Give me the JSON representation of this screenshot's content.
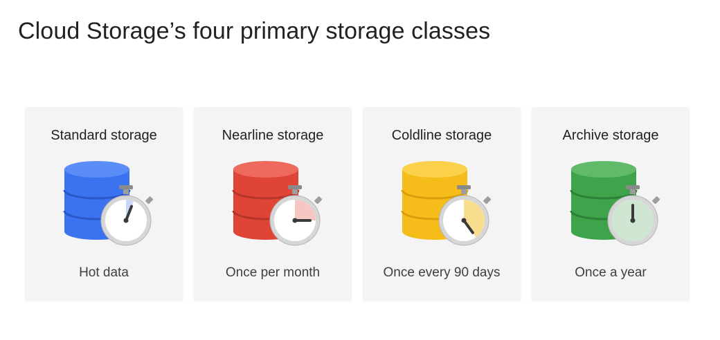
{
  "slide": {
    "title": "Cloud Storage’s four primary storage classes"
  },
  "cards": [
    {
      "title": "Standard storage",
      "caption": "Hot data",
      "icon": "database-stopwatch-icon",
      "colors": {
        "top": "#5b8df7",
        "body": "#3a72f0",
        "band": "#2a58c9",
        "wedge": "#c9d8f7"
      },
      "access_fraction": 0.06
    },
    {
      "title": "Nearline storage",
      "caption": "Once per month",
      "icon": "database-stopwatch-icon",
      "colors": {
        "top": "#ee6a5c",
        "body": "#df4436",
        "band": "#b7342a",
        "wedge": "#f6c7c2"
      },
      "access_fraction": 0.25
    },
    {
      "title": "Coldline storage",
      "caption": "Once every 90 days",
      "icon": "database-stopwatch-icon",
      "colors": {
        "top": "#fbd04a",
        "body": "#f6bd1a",
        "band": "#d99f0a",
        "wedge": "#f9dd8e"
      },
      "access_fraction": 0.4
    },
    {
      "title": "Archive storage",
      "caption": "Once a year",
      "icon": "database-stopwatch-icon",
      "colors": {
        "top": "#5fbb6a",
        "body": "#3ea34b",
        "band": "#2c8139",
        "wedge": "#cfe6d2"
      },
      "access_fraction": 1.0
    }
  ]
}
